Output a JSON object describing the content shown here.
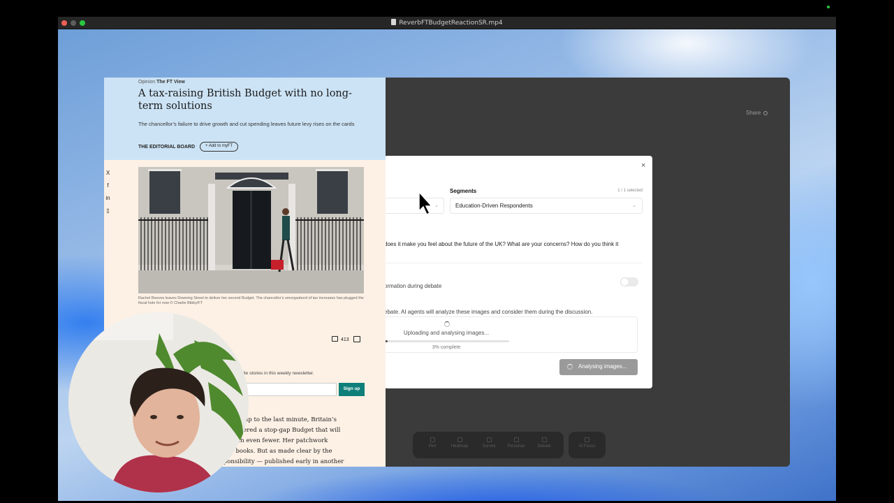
{
  "window": {
    "title": "ReverbFTBudgetReactionSR.mp4"
  },
  "background_app": {
    "share_label": "Share",
    "toolbar": [
      {
        "label": "Plot",
        "icon": "plot-icon"
      },
      {
        "label": "Heatmap",
        "icon": "heatmap-icon"
      },
      {
        "label": "Survey",
        "icon": "survey-icon"
      },
      {
        "label": "Personas",
        "icon": "personas-icon"
      },
      {
        "label": "Debate",
        "icon": "debate-icon"
      }
    ],
    "extra_tool_label": "AI Focus"
  },
  "modal": {
    "close_label": "×",
    "segments_label": "Segments",
    "segments_count": "1 / 1 selected",
    "segment_value": "Education-Driven Respondents",
    "prompt_text": "does it make you feel about the future of the UK? What are your concerns? How do you think it",
    "toggle_label": "ormation during debate",
    "images_desc": "ebate. AI agents will analyze these images and consider them during the discussion.",
    "upload_status": "Uploading and analysing images...",
    "progress_percent": 3,
    "progress_label": "3% complete",
    "analyse_button": "Analysing images..."
  },
  "article": {
    "kicker_section": "Opinion",
    "kicker_column": "The FT View",
    "title": "A tax-raising British Budget with no long-term solutions",
    "standfirst": "The chancellor’s failure to drive growth and cut spending leaves future levy rises on the cards",
    "byline": "THE EDITORIAL BOARD",
    "add_button": "+ Add to myFT",
    "social": [
      "X",
      "f",
      "in",
      "▯"
    ],
    "caption": "Rachel Reeves leaves Downing Street to deliver her second Budget. The chancellor’s smorgasbord of tax increases has plugged the fiscal hole for now © Charlie Bibby/FT",
    "comment_count": "413",
    "newsletter_title": "ree",
    "newsletter_desc": "ourite stories in this weekly newsletter.",
    "signup_label": "Sign up",
    "body_lines": [
      "urns right up to the last minute, Britain’s",
      "nally delivered a stop-gap Budget that will",
      "ptimism in even fewer. Her patchwork",
      "ces the books. But as made clear by the",
      "Responsibility — published early in another"
    ]
  }
}
